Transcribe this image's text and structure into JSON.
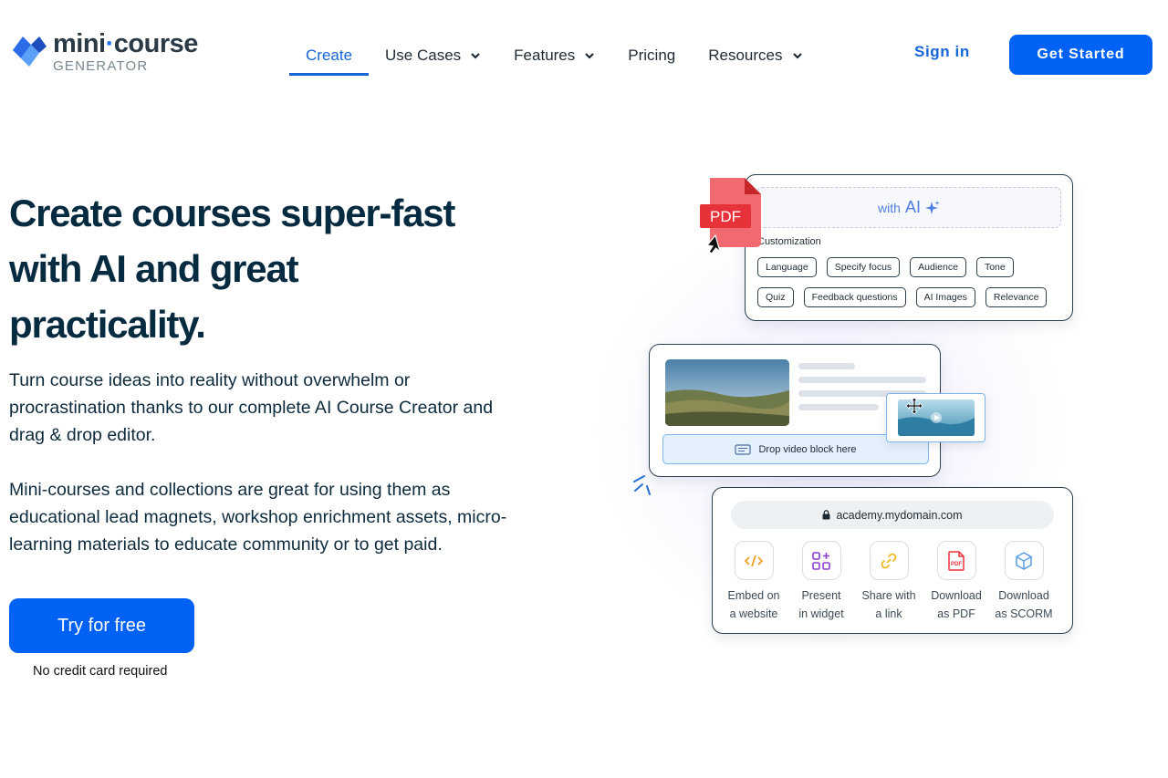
{
  "brand": {
    "name_part1": "mini",
    "name_dot": "·",
    "name_part2": "course",
    "sub": "GENERATOR"
  },
  "nav": {
    "items": [
      {
        "label": "Create",
        "active": true,
        "has_dropdown": false
      },
      {
        "label": "Use Cases",
        "active": false,
        "has_dropdown": true
      },
      {
        "label": "Features",
        "active": false,
        "has_dropdown": true
      },
      {
        "label": "Pricing",
        "active": false,
        "has_dropdown": false
      },
      {
        "label": "Resources",
        "active": false,
        "has_dropdown": true
      }
    ],
    "sign_in": "Sign in",
    "get_started": "Get Started"
  },
  "hero": {
    "title_line1": "Create courses super-fast",
    "title_line2": "with AI and great",
    "title_line3": "practicality.",
    "paragraph1": "Turn course ideas into reality without overwhelm or procrastination thanks to our complete AI Course Creator and drag & drop editor.",
    "paragraph2": "Mini-courses and collections are great for using them as educational lead magnets, workshop enrichment assets, micro-learning materials to educate community or to get paid.",
    "cta": "Try for free",
    "note": "No credit card required"
  },
  "illustration": {
    "pdf_label": "PDF",
    "ai_prefix": "with",
    "ai_label": "AI",
    "customization_label": "Customization",
    "chips_row1": [
      "Language",
      "Specify focus",
      "Audience",
      "Tone"
    ],
    "chips_row2": [
      "Quiz",
      "Feedback questions",
      "AI Images",
      "Relevance"
    ],
    "drop_label": "Drop video block here",
    "url": "academy.mydomain.com",
    "share_options": [
      {
        "line1": "Embed on",
        "line2": "a website",
        "icon": "code-icon"
      },
      {
        "line1": "Present",
        "line2": "in widget",
        "icon": "widget-icon"
      },
      {
        "line1": "Share with",
        "line2": "a link",
        "icon": "link-icon"
      },
      {
        "line1": "Download",
        "line2": "as PDF",
        "icon": "pdf-file-icon"
      },
      {
        "line1": "Download",
        "line2": "as SCORM",
        "icon": "cube-icon"
      }
    ]
  },
  "colors": {
    "primary": "#0061f5",
    "nav_active": "#1565d8",
    "heading": "#062a3f",
    "pdf_red": "#e8323a"
  }
}
